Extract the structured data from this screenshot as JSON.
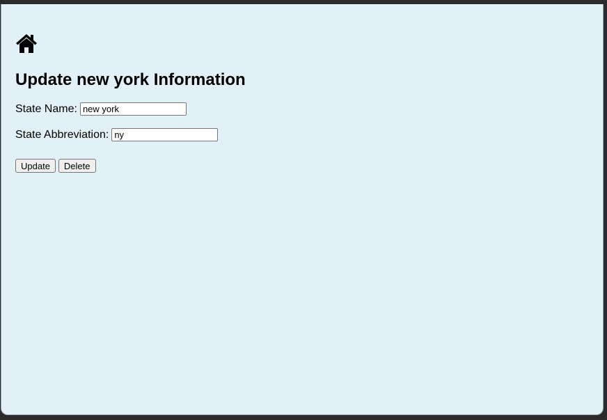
{
  "header": {
    "home_icon": "home-icon",
    "title": "Update new york Information"
  },
  "form": {
    "state_name_label": "State Name:",
    "state_name_value": "new york",
    "state_abbr_label": "State Abbreviation:",
    "state_abbr_value": "ny",
    "update_label": "Update",
    "delete_label": "Delete"
  },
  "colors": {
    "page_background": "#e2f1f7",
    "window_frame": "#2b2b2b"
  }
}
